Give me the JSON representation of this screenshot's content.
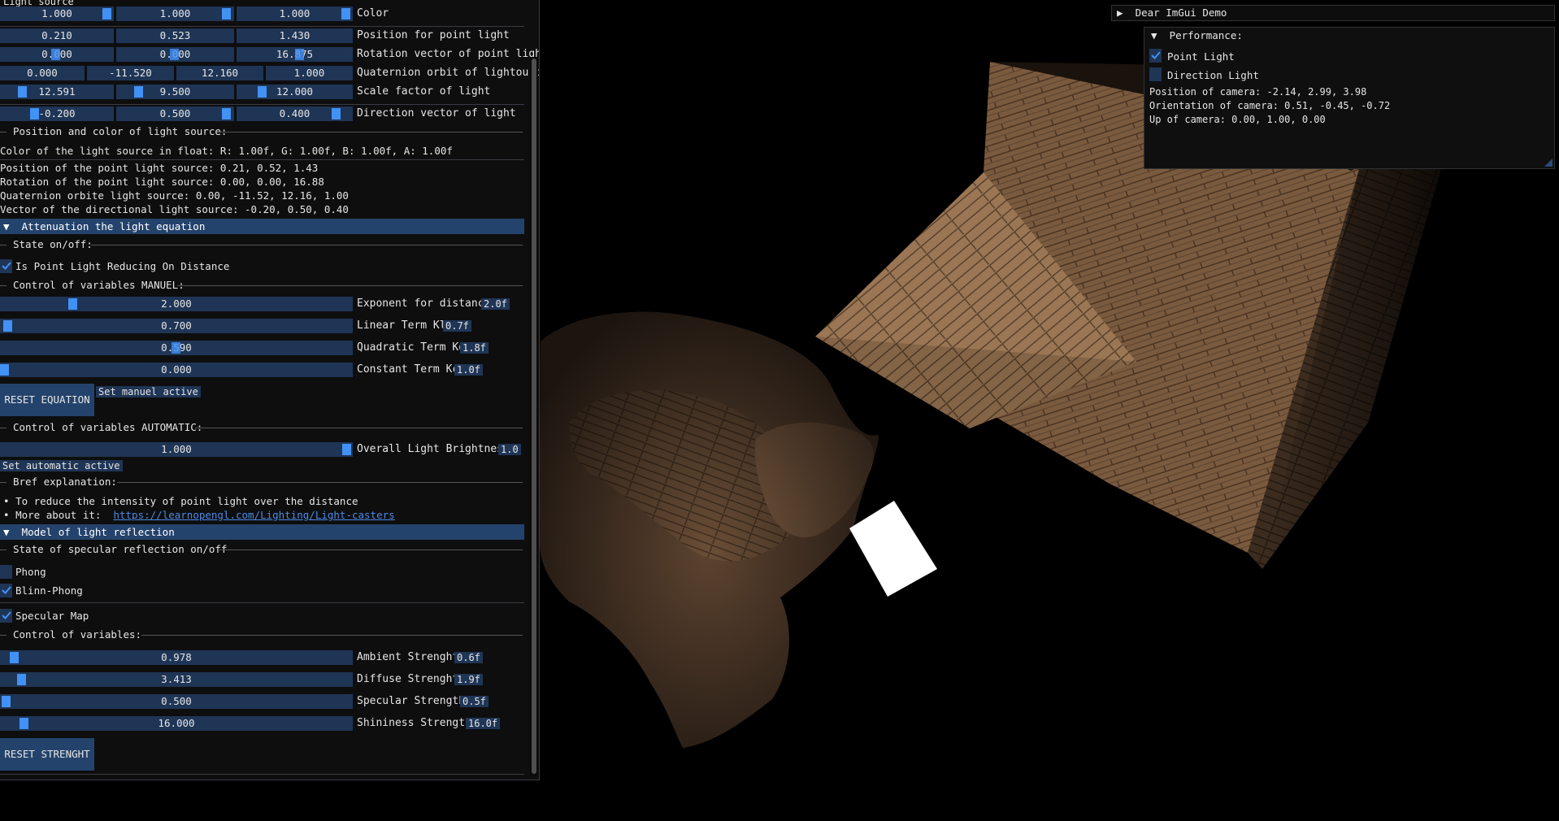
{
  "light_source": {
    "header": "Light source",
    "color": {
      "values": [
        "1.000",
        "1.000",
        "1.000"
      ],
      "label": "Color"
    },
    "position": {
      "values": [
        "0.210",
        "0.523",
        "1.430"
      ],
      "label": "Position for point light"
    },
    "rotation": {
      "values": [
        "0.000",
        "0.000",
        "16.875"
      ],
      "label": "Rotation vector of point light"
    },
    "quaternion": {
      "values": [
        "0.000",
        "-11.520",
        "12.160",
        "1.000"
      ],
      "label": "Quaternion orbit of lightource"
    },
    "scale": {
      "values": [
        "12.591",
        "9.500",
        "12.000"
      ],
      "label": "Scale factor of light"
    },
    "direction": {
      "values": [
        "-0.200",
        "0.500",
        "0.400"
      ],
      "label": "Direction vector of light"
    },
    "separator_label": "Position and color of light source:",
    "info_color": "Color of the light source in float: R: 1.00f, G: 1.00f, B: 1.00f, A: 1.00f",
    "info_position": "Position of the point light source: 0.21, 0.52, 1.43",
    "info_rotation": "Rotation of the point light source: 0.00, 0.00, 16.88",
    "info_quaternion": "Quaternion orbite light source: 0.00, -11.52, 12.16, 1.00",
    "info_vector": "Vector of the directional light source: -0.20, 0.50, 0.40"
  },
  "attenuation": {
    "header": "Attenuation the light equation",
    "state_label": "State on/off:",
    "checkbox_label": "Is Point Light Reducing On Distance",
    "manual_label": "Control of variables MANUEL:",
    "exponent": {
      "value": "2.000",
      "label": "Exponent for distance:",
      "tag": "2.0f",
      "fill": 0.2
    },
    "linear": {
      "value": "0.700",
      "label": "Linear Term Kl:",
      "tag": "0.7f",
      "fill": 0.0
    },
    "quadratic": {
      "value": "0.590",
      "label": "Quadratic Term Kq:",
      "tag": "1.8f",
      "fill": 0.5
    },
    "constant": {
      "value": "0.000",
      "label": "Constant Term Kc:",
      "tag": "1.0f",
      "fill": 0.0
    },
    "reset_button": "RESET EQUATION",
    "set_manual": "Set manuel active",
    "auto_label": "Control of variables AUTOMATIC:",
    "brightness": {
      "value": "1.000",
      "label": "Overall Light Brightness:",
      "tag": "1.0",
      "fill": 1.0
    },
    "set_auto": "Set automatic active",
    "explain_label": "Bref explanation:",
    "bullet1": "To reduce the intensity of point light over the distance",
    "bullet2_prefix": "More about it:",
    "bullet2_link": "https://learnopengl.com/Lighting/Light-casters"
  },
  "reflection": {
    "header": "Model of light reflection",
    "state_label": "State of specular reflection on/off",
    "phong": "Phong",
    "blinn": "Blinn-Phong",
    "specular_map": "Specular Map",
    "control_label": "Control of variables:",
    "ambient": {
      "value": "0.978",
      "label": "Ambient Strenght:",
      "tag": "0.6f",
      "fill": 0.03
    },
    "diffuse": {
      "value": "3.413",
      "label": "Diffuse Strenght:",
      "tag": "1.9f",
      "fill": 0.05
    },
    "specular": {
      "value": "0.500",
      "label": "Specular Strength:",
      "tag": "0.5f",
      "fill": 0.0
    },
    "shininess": {
      "value": "16.000",
      "label": "Shininess Strength:",
      "tag": "16.0f",
      "fill": 0.06
    },
    "reset_button": "RESET STRENGHT"
  },
  "overlay": {
    "demo_title": "Dear ImGui Demo",
    "perf_title": "Performance:",
    "point_light": "Point Light",
    "direction_light": "Direction Light",
    "cam_pos": "Position of camera: -2.14, 2.99, 3.98",
    "cam_orient": "Orientation of camera: 0.51, -0.45, -0.72",
    "cam_up": "Up of camera: 0.00, 1.00, 0.00"
  }
}
